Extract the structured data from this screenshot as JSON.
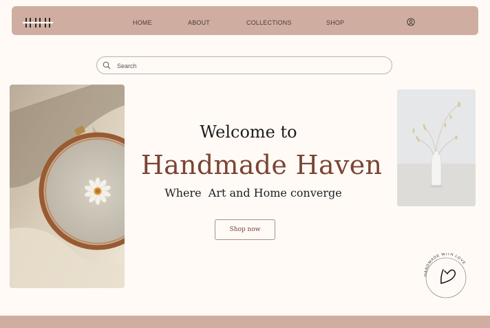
{
  "nav": {
    "logo_text": "HHH",
    "links": [
      "HOME",
      "ABOUT",
      "COLLECTIONS",
      "SHOP"
    ],
    "account_icon": "user-circle-icon"
  },
  "search": {
    "placeholder": "Search",
    "value": "",
    "icon": "search-icon"
  },
  "hero": {
    "welcome": "Welcome to",
    "brand": "Handmade Haven",
    "tagline": "Where  Art and Home converge",
    "cta_label": "Shop now"
  },
  "badge": {
    "text": "HANDMADE WITH LOVE",
    "icon": "heart-icon"
  },
  "colors": {
    "nav_bg": "#cfaea1",
    "page_bg": "#fffaf6",
    "brand": "#7a4434",
    "text": "#1d1d1d"
  }
}
